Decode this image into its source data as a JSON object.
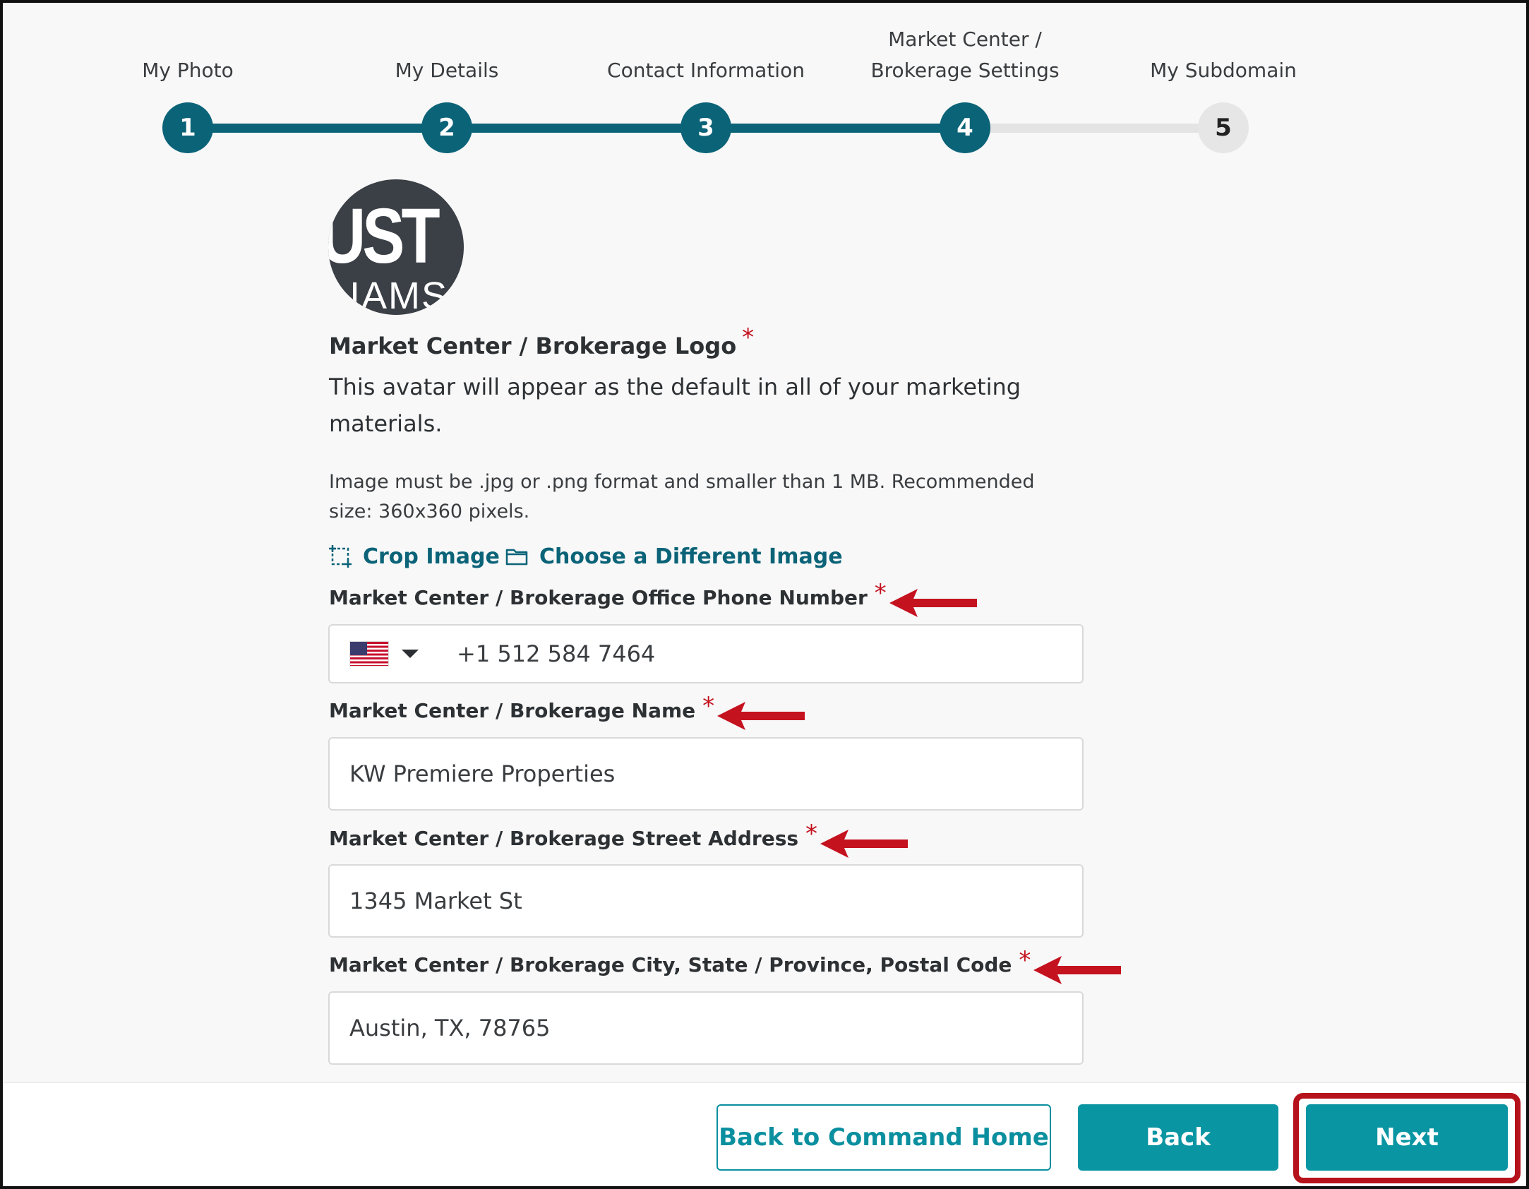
{
  "stepper": {
    "steps": [
      {
        "number": "1",
        "label": "My Photo",
        "state": "complete"
      },
      {
        "number": "2",
        "label": "My Details",
        "state": "complete"
      },
      {
        "number": "3",
        "label": "Contact Information",
        "state": "complete"
      },
      {
        "number": "4",
        "label_line1": "Market Center /",
        "label_line2": "Brokerage Settings",
        "state": "current"
      },
      {
        "number": "5",
        "label": "My Subdomain",
        "state": "pending"
      }
    ]
  },
  "logo": {
    "avatar_text_1": "UST",
    "avatar_text_2": "IAMS",
    "title": "Market Center / Brokerage Logo",
    "required_mark": "*",
    "description": "This avatar will appear as the default in all of your marketing materials.",
    "hint": "Image must be .jpg or .png format and smaller than 1 MB. Recommended size: 360x360 pixels.",
    "crop_label": "Crop Image",
    "choose_label": "Choose a Different Image"
  },
  "fields": {
    "phone": {
      "label": "Market Center / Brokerage Office Phone Number",
      "value": "+1 512 584 7464",
      "country_icon": "us-flag-icon"
    },
    "name": {
      "label": "Market Center / Brokerage Name",
      "value": "KW Premiere Properties"
    },
    "street": {
      "label": "Market Center / Brokerage Street Address",
      "value": "1345 Market St"
    },
    "city": {
      "label": "Market Center / Brokerage City, State / Province, Postal Code",
      "value": "Austin, TX, 78765"
    }
  },
  "footer": {
    "back_home_label": "Back to Command Home",
    "back_label": "Back",
    "next_label": "Next"
  },
  "colors": {
    "primary": "#0b6378",
    "button": "#0a95a3",
    "required": "#c4121f",
    "annotation": "#b5121b"
  }
}
